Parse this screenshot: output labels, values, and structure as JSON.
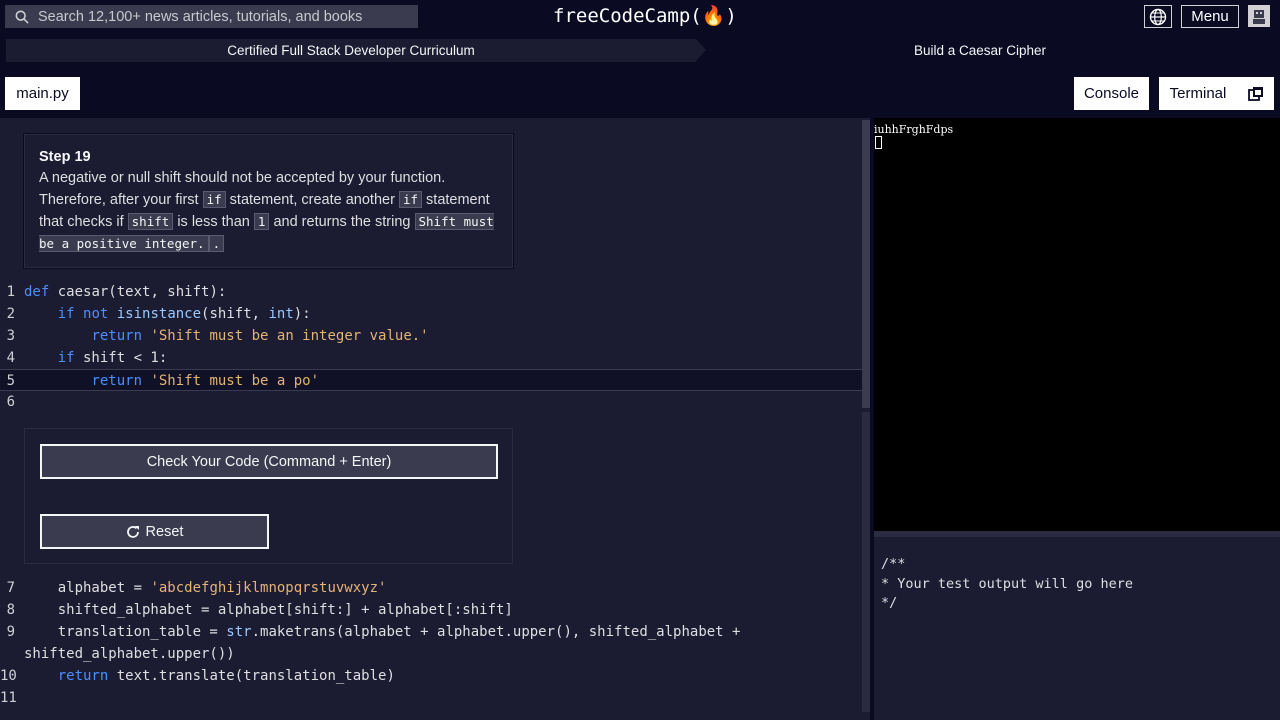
{
  "nav": {
    "search_placeholder": "Search 12,100+ news articles, tutorials, and books",
    "brand": "freeCodeCamp(🔥)",
    "menu_label": "Menu"
  },
  "breadcrumb": {
    "curriculum": "Certified Full Stack Developer Curriculum",
    "project": "Build a Caesar Cipher"
  },
  "toolbar": {
    "file_tab": "main.py",
    "console_label": "Console",
    "terminal_label": "Terminal"
  },
  "instructions": {
    "step_title": "Step 19",
    "part1": "A negative or null shift should not be accepted by your function. Therefore, after your first ",
    "code1": "if",
    "part2": " statement, create another ",
    "code2": "if",
    "part3": " statement that checks if ",
    "code3": "shift",
    "part4": " is less than ",
    "code4": "1",
    "part5": " and returns the string ",
    "code5": "Shift must be a positive integer.",
    "part6": "."
  },
  "buttons": {
    "check": "Check Your Code (Command + Enter)",
    "reset": "Reset"
  },
  "code_top": [
    {
      "n": "1",
      "text": "def caesar(text, shift):"
    },
    {
      "n": "2",
      "text": "    if not isinstance(shift, int):"
    },
    {
      "n": "3",
      "text": "        return 'Shift must be an integer value.'"
    },
    {
      "n": "4",
      "text": "    if shift < 1:"
    },
    {
      "n": "5",
      "text": "        return 'Shift must be a po'"
    },
    {
      "n": "6",
      "text": ""
    }
  ],
  "code_bottom": [
    {
      "n": "7",
      "text": "    alphabet = 'abcdefghijklmnopqrstuvwxyz'"
    },
    {
      "n": "8",
      "text": "    shifted_alphabet = alphabet[shift:] + alphabet[:shift]"
    },
    {
      "n": "9",
      "text": "    translation_table = str.maketrans(alphabet + alphabet.upper(), shifted_alphabet +"
    },
    {
      "n": "",
      "text": "shifted_alphabet.upper())"
    },
    {
      "n": "10",
      "text": "    return text.translate(translation_table)"
    },
    {
      "n": "11",
      "text": ""
    }
  ],
  "preview": {
    "output": "iuhhFrghFdps"
  },
  "test_output": {
    "text": "/**\n* Your test output will go here\n*/"
  }
}
